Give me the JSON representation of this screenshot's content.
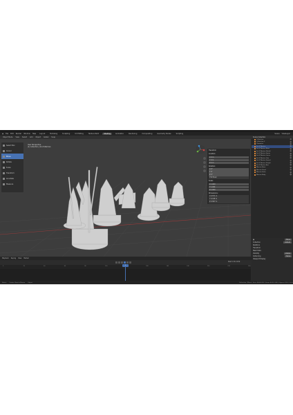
{
  "app": {
    "title": "Blender"
  },
  "menubar": {
    "items": [
      "File",
      "Edit",
      "Render",
      "Window",
      "Help"
    ],
    "workspaces": [
      "Layout",
      "Modeling",
      "Sculpting",
      "UV Editing",
      "Texture Paint",
      "Shading",
      "Animation",
      "Rendering",
      "Compositing",
      "Geometry Nodes",
      "Scripting"
    ],
    "active_workspace": "Shading",
    "scene": "Scene",
    "view_layer": "ViewLayer"
  },
  "header": {
    "mode": "Object Mode",
    "view": "View",
    "select": "Select",
    "add": "Add",
    "object": "Object",
    "orientation": "Global",
    "snap": "Snap"
  },
  "viewport": {
    "info_title": "User Perspective",
    "info_collection": "(1) Collection | Sci-fi Warriors"
  },
  "tools": [
    {
      "label": "Select Box",
      "active": false
    },
    {
      "label": "Cursor",
      "active": false
    },
    {
      "label": "Move",
      "active": true
    },
    {
      "label": "Rotate",
      "active": false
    },
    {
      "label": "Scale",
      "active": false
    },
    {
      "label": "Transform",
      "active": false
    },
    {
      "label": "Annotate",
      "active": false
    },
    {
      "label": "Measure",
      "active": false
    }
  ],
  "npanel": {
    "title": "Transform",
    "location_label": "Location:",
    "location": [
      "X 0 m",
      "Y 0 m",
      "Z 0 m"
    ],
    "rotation_label": "Rotation:",
    "rotation": [
      "X 0°",
      "Y 0°",
      "Z 0°"
    ],
    "mode": "XYZ Euler",
    "scale_label": "Scale:",
    "scale": [
      "X 1.000",
      "Y 1.000",
      "Z 1.000"
    ],
    "dimensions_label": "Dimensions:",
    "dimensions": [
      "X 0.571 m",
      "Y 0.418 m",
      "Z 0.587 m"
    ]
  },
  "outliner": {
    "title": "Scene Collection",
    "items": [
      "Collection",
      "Collection 2",
      "Character",
      "Sci-fi Warrior",
      "Sci-fi Warrior Base",
      "Sci-fi Warrior Shield",
      "Sci-fi Warrior Spear",
      "Sci-fi Warrior Lance",
      "Sci-fi Warrior Gun",
      "Sci-fi Warrior Sword",
      "Sci-fi Warrior Knight",
      "Sci-fi Warrior Axe",
      "Warrior Base",
      "Warrior Head",
      "Warrior Helm",
      "Warrior Body"
    ],
    "selected_index": 3
  },
  "properties": {
    "object_name": "Plane",
    "rows": [
      {
        "label": "Collection",
        "value": "default"
      },
      {
        "label": "Relations",
        "value": ""
      },
      {
        "label": "Transform",
        "value": ""
      },
      {
        "label": "Mesh Data",
        "value": ""
      },
      {
        "label": "Visibility",
        "value": "Visible"
      },
      {
        "label": "Instancing",
        "value": "None"
      },
      {
        "label": "Viewport Display",
        "value": ""
      }
    ]
  },
  "timeline": {
    "menu": [
      "Playback",
      "Keying",
      "View",
      "Marker"
    ],
    "current_frame": "1",
    "start_label": "Start",
    "start": "1",
    "end_label": "End",
    "end": "250",
    "ruler": [
      "0",
      "20",
      "40",
      "60",
      "80",
      "100",
      "120",
      "140",
      "160",
      "180",
      "200",
      "220",
      "240"
    ]
  },
  "statusbar": {
    "left": "Select",
    "middle": "Center View to Mouse",
    "right_hint": "Object",
    "version": "Collection | Plane | Verts 8,624,232 | Faces 8,551,128 | Objects 1/20 | 3.0.0"
  },
  "colors": {
    "accent": "#4772b3",
    "background": "#3d3d3d",
    "panel": "#2b2b2b",
    "model": "#d8d8d8"
  }
}
